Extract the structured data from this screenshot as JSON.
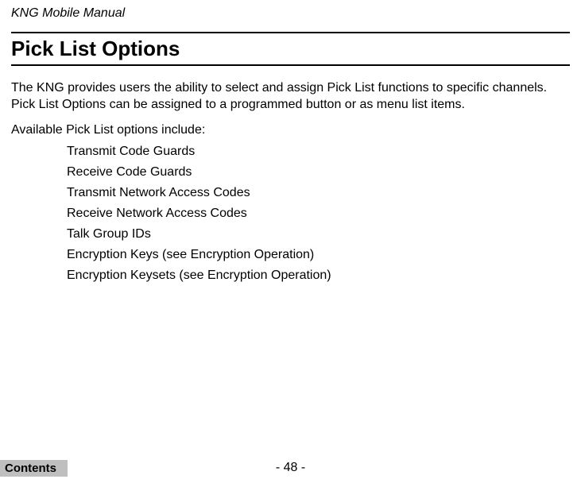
{
  "document_header": "KNG Mobile Manual",
  "section_title": "Pick List Options",
  "intro": "The KNG provides users the ability to select and assign Pick List functions to specific channels. Pick List Options can be assigned to a programmed button or as menu list items.",
  "list_intro": "Available Pick List options include:",
  "options": [
    "Transmit Code Guards",
    "Receive Code Guards",
    "Transmit Network Access Codes",
    "Receive Network Access Codes",
    "Talk Group IDs",
    "Encryption Keys (see Encryption Operation)",
    "Encryption Keysets (see Encryption Operation)"
  ],
  "page_number": "- 48 -",
  "contents_label": "Contents"
}
